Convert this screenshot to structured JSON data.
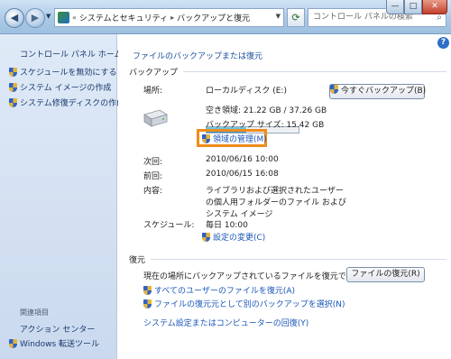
{
  "titlebar": {
    "breadcrumb_prefix": "«",
    "breadcrumb_1": "システムとセキュリティ",
    "breadcrumb_sep": "▸",
    "breadcrumb_2": "バックアップと復元",
    "search_placeholder": "コントロール パネルの検索",
    "minimize": "—",
    "maximize": "□",
    "close": "✕"
  },
  "left": {
    "home": "コントロール パネル ホーム",
    "links": [
      "スケジュールを無効にする",
      "システム イメージの作成",
      "システム修復ディスクの作成"
    ],
    "related_heading": "関連項目",
    "related": [
      "アクション センター",
      "Windows 転送ツール"
    ]
  },
  "main": {
    "title": "ファイルのバックアップまたは復元",
    "backup": {
      "heading": "バックアップ",
      "location_label": "場所:",
      "location_value": "ローカルディスク (E:)",
      "free_space": "空き領域: 21.22 GB / 37.26 GB",
      "usage_fraction": 0.43,
      "backup_size": "バックアップ サイズ: 15.42 GB",
      "manage_link": "領域の管理(M)",
      "backup_now_button": "今すぐバックアップ(B)",
      "next_label": "次回:",
      "next_value": "2010/06/16 10:00",
      "prev_label": "前回:",
      "prev_value": "2010/06/15 16:08",
      "contents_label": "内容:",
      "contents_line1": "ライブラリおよび選択されたユーザー",
      "contents_line2": "の個人用フォルダーのファイル および",
      "contents_line3": "システム イメージ",
      "schedule_label": "スケジュール:",
      "schedule_value": "毎日 10:00",
      "change_settings_link": "設定の変更(C)"
    },
    "restore": {
      "heading": "復元",
      "description": "現在の場所にバックアップされているファイルを復元できます。",
      "restore_files_button": "ファイルの復元(R)",
      "restore_all_users_link": "すべてのユーザーのファイルを復元(A)",
      "select_other_link": "ファイルの復元元として別のバックアップを選択(N)",
      "recover_system_link": "システム設定またはコンピューターの回復(Y)"
    }
  }
}
